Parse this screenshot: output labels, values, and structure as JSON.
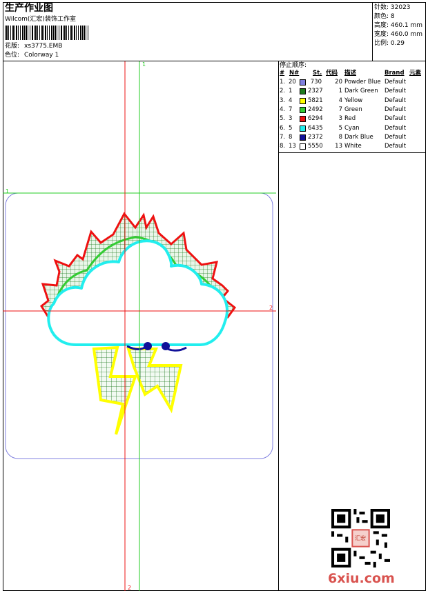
{
  "header": {
    "title": "生产作业图",
    "company": "Wilcom(汇宏)装饰工作室",
    "pattern_label": "花版:",
    "pattern_value": "xs3775.EMB",
    "colorway_label": "色位:",
    "colorway_value": "Colorway 1"
  },
  "stats": {
    "stitches": "针数: 32023",
    "colors": "颜色: 8",
    "height": "高度: 460.1 mm",
    "width": "宽度: 460.0 mm",
    "ratio": "比例: 0.29"
  },
  "sequence": {
    "title": "停止顺序:",
    "headers": [
      "#",
      "N#",
      "St.",
      "代码",
      "描述",
      "Brand",
      "元素"
    ],
    "rows": [
      {
        "idx": "1.",
        "n": "20",
        "color": "#8080e0",
        "st": "730",
        "code": "20",
        "desc": "Powder Blue",
        "brand": "Default"
      },
      {
        "idx": "2.",
        "n": "1",
        "color": "#1e7a1e",
        "st": "2327",
        "code": "1",
        "desc": "Dark Green",
        "brand": "Default"
      },
      {
        "idx": "3.",
        "n": "4",
        "color": "#ffff00",
        "st": "5821",
        "code": "4",
        "desc": "Yellow",
        "brand": "Default"
      },
      {
        "idx": "4.",
        "n": "7",
        "color": "#33cc33",
        "st": "2492",
        "code": "7",
        "desc": "Green",
        "brand": "Default"
      },
      {
        "idx": "5.",
        "n": "3",
        "color": "#ee1111",
        "st": "6294",
        "code": "3",
        "desc": "Red",
        "brand": "Default"
      },
      {
        "idx": "6.",
        "n": "5",
        "color": "#22eeee",
        "st": "6435",
        "code": "5",
        "desc": "Cyan",
        "brand": "Default"
      },
      {
        "idx": "7.",
        "n": "8",
        "color": "#111199",
        "st": "2372",
        "code": "8",
        "desc": "Dark Blue",
        "brand": "Default"
      },
      {
        "idx": "8.",
        "n": "13",
        "color": "#ffffff",
        "st": "5550",
        "code": "13",
        "desc": "White",
        "brand": "Default"
      }
    ]
  },
  "axes": {
    "green_top": "1",
    "green_left": "1",
    "red_right": "2",
    "red_bottom": "2"
  },
  "watermark": "6xiu.com",
  "stamp_text": "汇宏"
}
